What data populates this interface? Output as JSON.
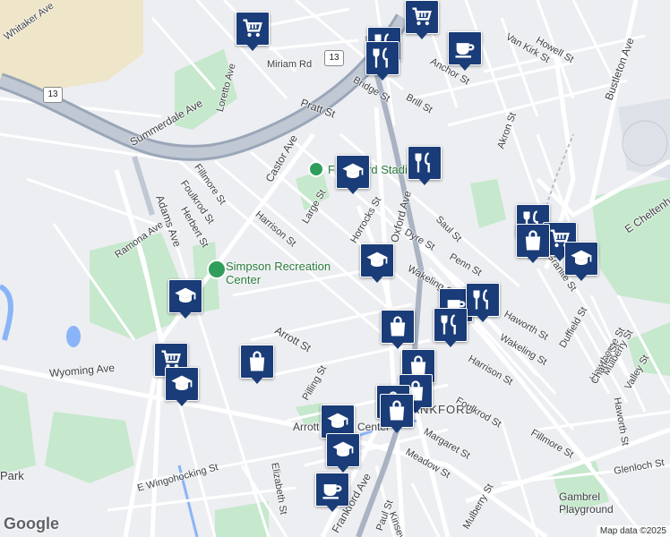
{
  "map": {
    "street_labels": [
      "Miriam Rd",
      "Summerdale Ave",
      "Loretto Ave",
      "Castor Ave",
      "Pratt St",
      "Bridge St",
      "Brill St",
      "Fillmore St",
      "Foulkrod St",
      "Herbert St",
      "Adams Ave",
      "Ramona Ave",
      "Harrison St",
      "Large St",
      "Horrocks St",
      "Oxford Ave",
      "Dyre St",
      "Saul St",
      "Wakeling St",
      "Penn St",
      "Arrott St",
      "Wyoming Ave",
      "Pilling St",
      "Margaret St",
      "Meadow St",
      "Elizabeth St",
      "E Wingohocking St",
      "Frankford Ave",
      "Paul St",
      "Granite St",
      "Duffield St",
      "Hawthorne St",
      "Mulberry St",
      "Charles St",
      "Valley St",
      "Haworth St",
      "Glenloch St",
      "Akron St",
      "Howell St",
      "Van Kirk St",
      "Anchor St",
      "Bustleton Ave",
      "E Cheltenham Ave",
      "Mulberry St",
      "Kinsey St",
      "Wakeling St",
      "Haworth St",
      "Harrison St",
      "Foulkrod St",
      "Fillmore St",
      "Whitaker Ave"
    ],
    "places": [
      {
        "name": "Simpson Recreation Center"
      },
      {
        "name": "Frankford Stadium"
      },
      {
        "name": "Arrott Transit Center"
      },
      {
        "name": "Gambrel Playground"
      },
      {
        "name": "FRANKFORD"
      },
      {
        "name": "Park"
      }
    ],
    "route_shields": [
      "13",
      "13"
    ],
    "markers": [
      {
        "type": "grocery"
      },
      {
        "type": "grocery"
      },
      {
        "type": "restaurant"
      },
      {
        "type": "cafe"
      },
      {
        "type": "restaurant"
      },
      {
        "type": "school"
      },
      {
        "type": "restaurant"
      },
      {
        "type": "school"
      },
      {
        "type": "restaurant"
      },
      {
        "type": "grocery"
      },
      {
        "type": "shopping"
      },
      {
        "type": "school"
      },
      {
        "type": "school"
      },
      {
        "type": "cafe"
      },
      {
        "type": "restaurant"
      },
      {
        "type": "grocery"
      },
      {
        "type": "school"
      },
      {
        "type": "shopping"
      },
      {
        "type": "restaurant"
      },
      {
        "type": "shopping"
      },
      {
        "type": "shopping"
      },
      {
        "type": "shopping"
      },
      {
        "type": "shopping"
      },
      {
        "type": "shopping"
      },
      {
        "type": "school"
      },
      {
        "type": "school"
      },
      {
        "type": "cafe"
      }
    ],
    "logo": "Google",
    "credit": "Map data ©2025"
  }
}
